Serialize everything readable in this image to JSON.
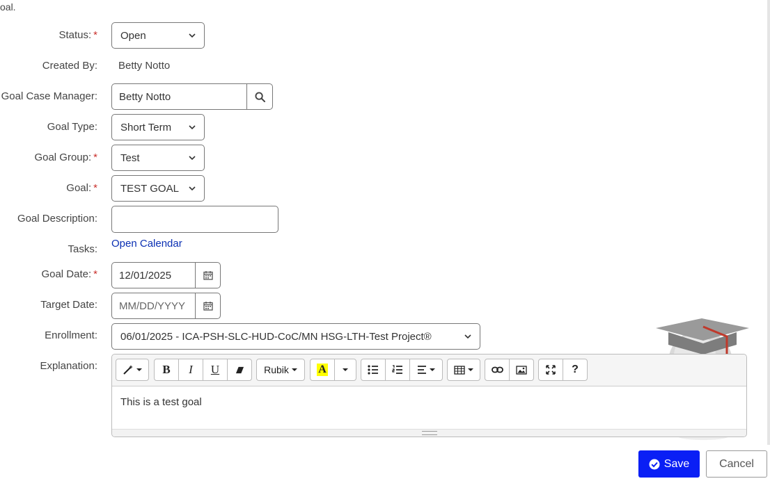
{
  "intro_text": "oal.",
  "form": {
    "status": {
      "label": "Status:",
      "value": "Open"
    },
    "created_by": {
      "label": "Created By:",
      "value": "Betty Notto"
    },
    "case_manager": {
      "label": "Goal Case Manager:",
      "value": "Betty Notto"
    },
    "goal_type": {
      "label": "Goal Type:",
      "value": "Short Term"
    },
    "goal_group": {
      "label": "Goal Group:",
      "value": "Test"
    },
    "goal": {
      "label": "Goal:",
      "value": "TEST GOAL"
    },
    "goal_description": {
      "label": "Goal Description:",
      "value": ""
    },
    "tasks": {
      "label": "Tasks:",
      "link": "Open Calendar"
    },
    "goal_date": {
      "label": "Goal Date:",
      "value": "12/01/2025"
    },
    "target_date": {
      "label": "Target Date:",
      "placeholder": "MM/DD/YYYY"
    },
    "enrollment": {
      "label": "Enrollment:",
      "value": "06/01/2025 - ICA-PSH-SLC-HUD-CoC/MN HSG-LTH-Test Project®"
    },
    "explanation": {
      "label": "Explanation:",
      "content": "This is a test goal"
    }
  },
  "required_mark": "*",
  "editor_toolbar": {
    "font_name": "Rubik",
    "bold": "B",
    "italic": "I",
    "underline": "U",
    "highlight": "A",
    "help": "?"
  },
  "actions": {
    "save": "Save",
    "cancel": "Cancel"
  },
  "colors": {
    "primary": "#0a1ff5",
    "link": "#0a2fb3",
    "required": "#c9302c"
  }
}
